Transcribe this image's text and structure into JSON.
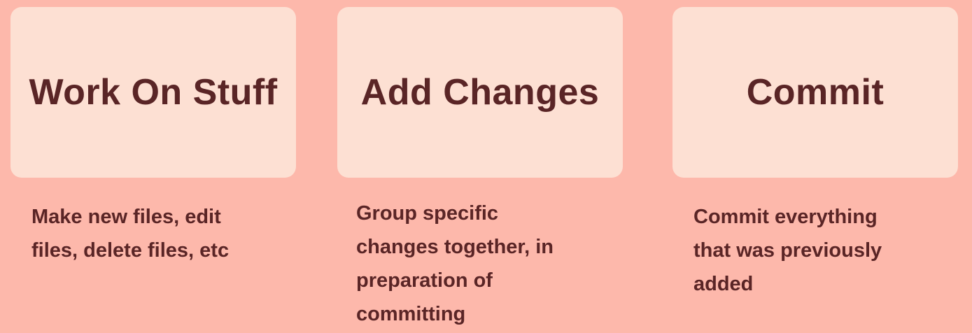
{
  "steps": [
    {
      "title": "Work On Stuff",
      "description_lines": [
        "Make new files, edit",
        "files, delete files, etc"
      ]
    },
    {
      "title": "Add Changes",
      "description_lines": [
        "Group specific",
        "changes together, in",
        "preparation of",
        "committing"
      ]
    },
    {
      "title": "Commit",
      "description_lines": [
        "Commit everything",
        "that was previously",
        "added"
      ]
    }
  ],
  "colors": {
    "background": "#fdb8ab",
    "card": "#fde0d3",
    "text": "#5a2526"
  }
}
